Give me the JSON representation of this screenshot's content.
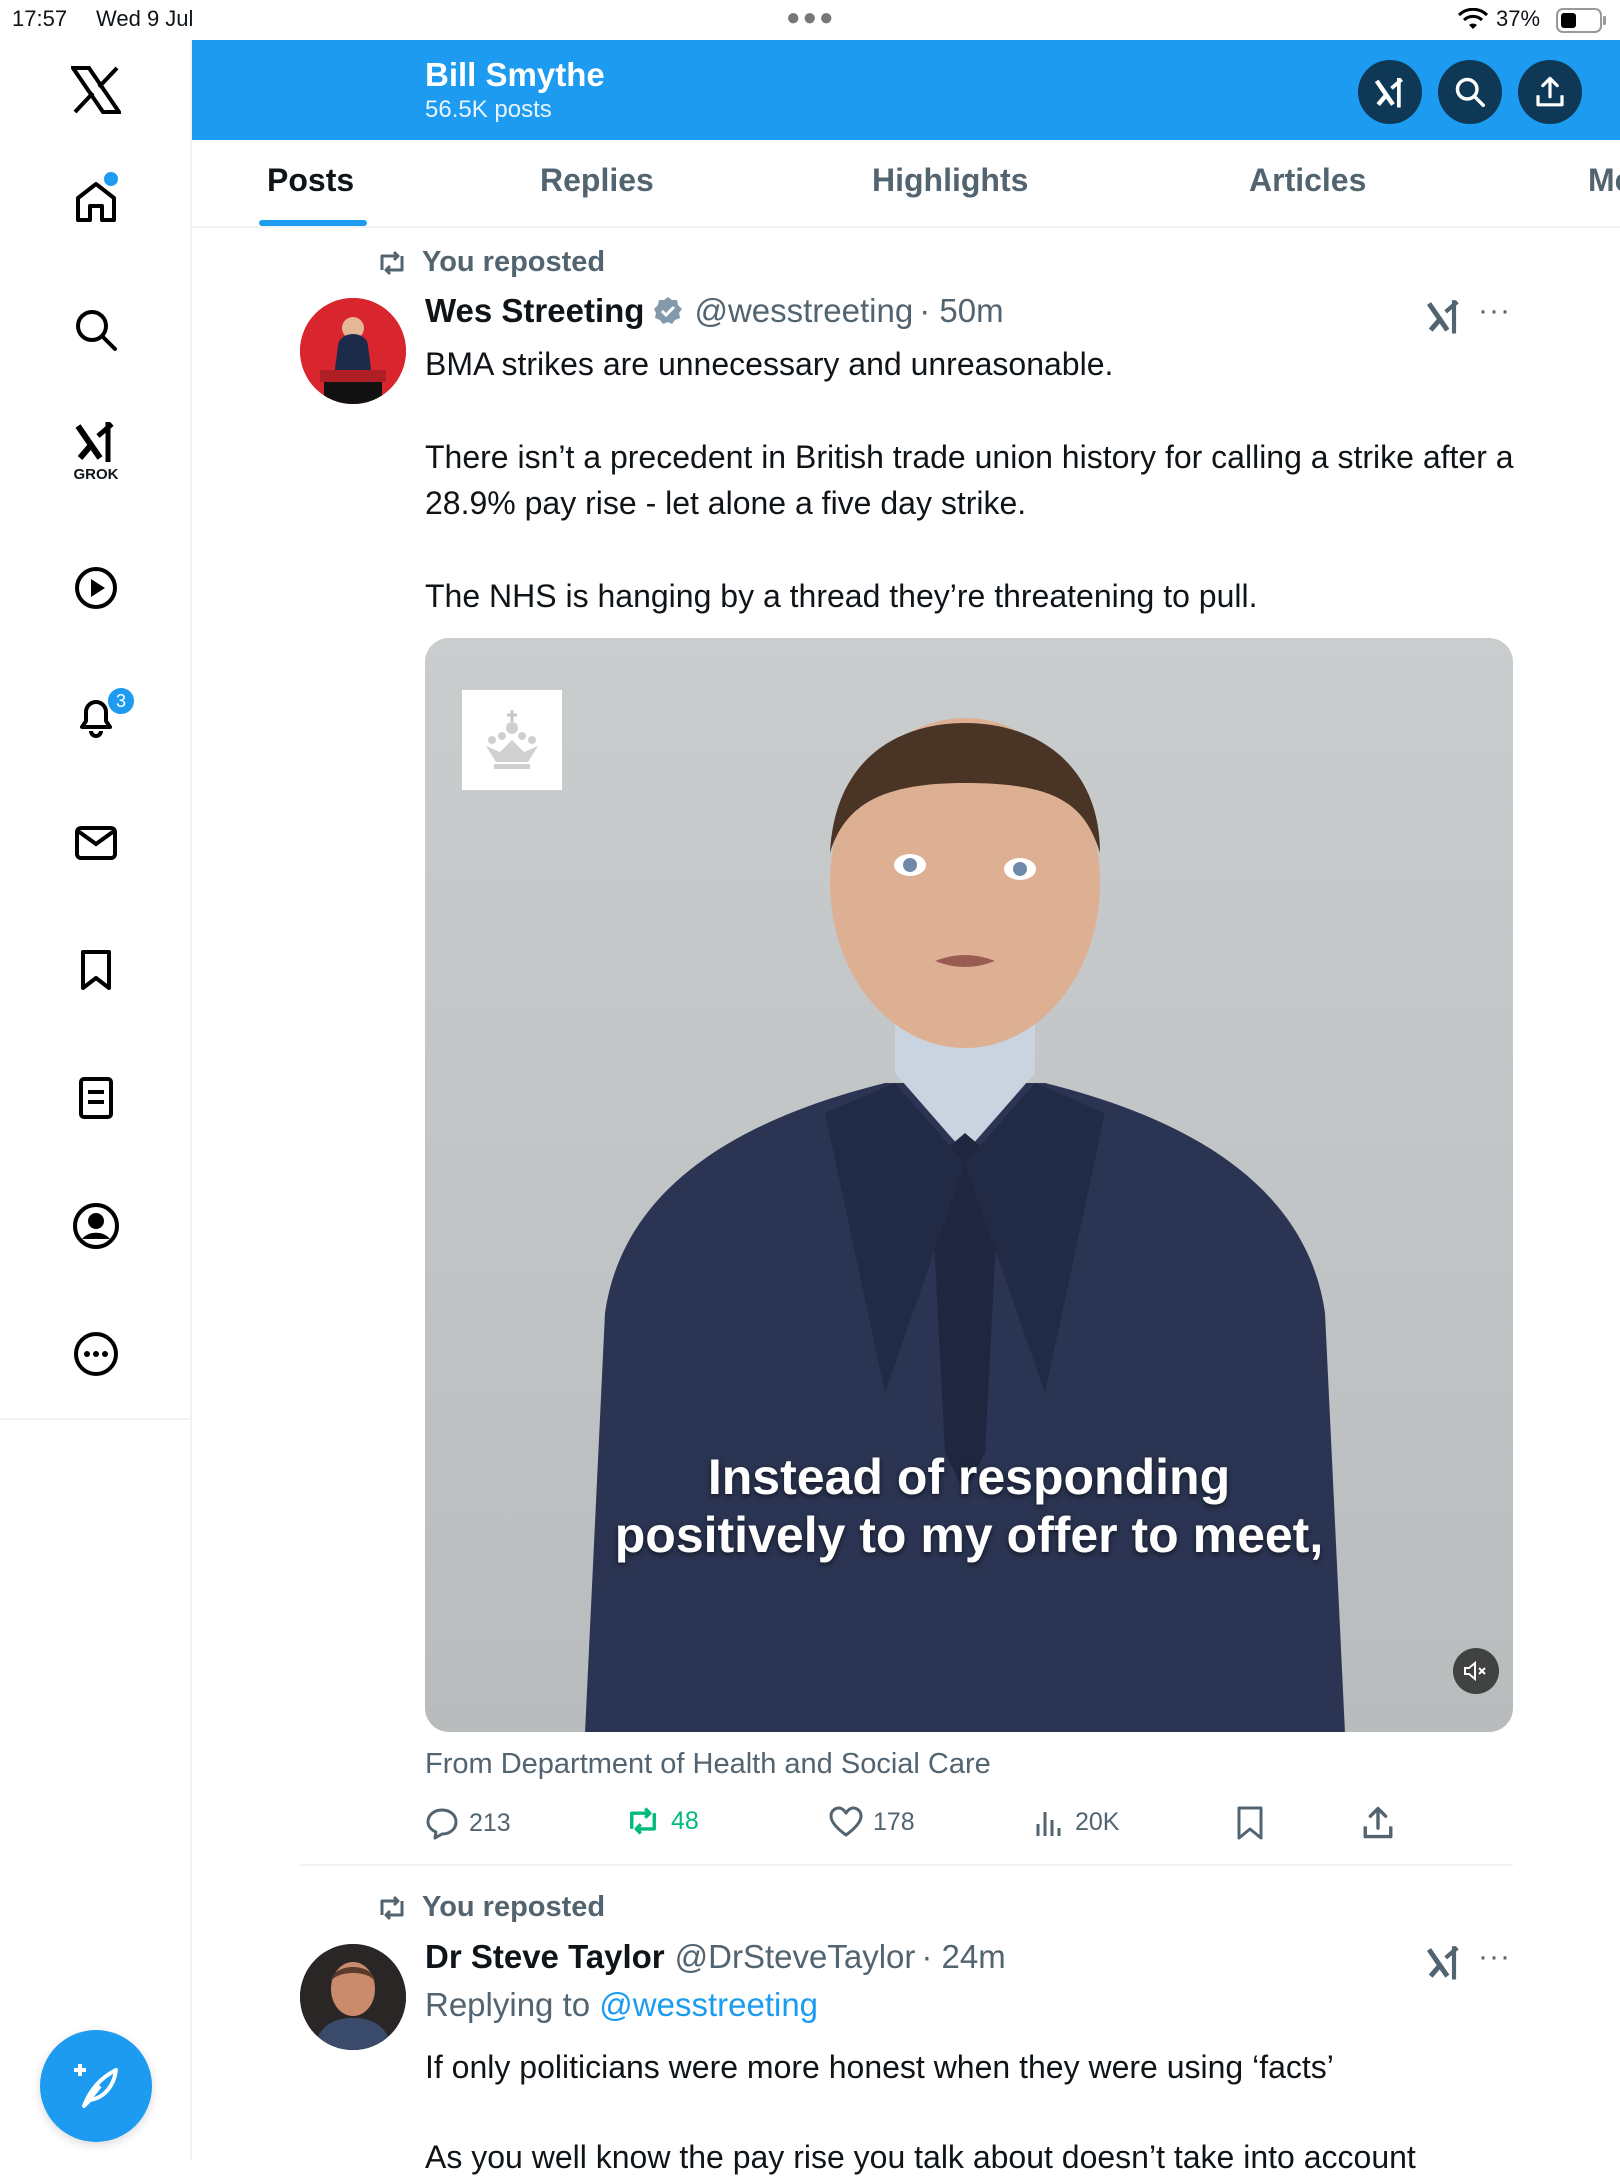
{
  "status_bar": {
    "time": "17:57",
    "date": "Wed 9 Jul",
    "battery": "37%"
  },
  "sidebar": {
    "items": [
      {
        "id": "home",
        "label": ""
      },
      {
        "id": "search",
        "label": ""
      },
      {
        "id": "grok",
        "label": "GROK"
      },
      {
        "id": "video",
        "label": ""
      },
      {
        "id": "notifications",
        "label": "",
        "badge": "3"
      },
      {
        "id": "messages",
        "label": ""
      },
      {
        "id": "bookmarks",
        "label": ""
      },
      {
        "id": "lists",
        "label": ""
      },
      {
        "id": "profile",
        "label": ""
      },
      {
        "id": "more",
        "label": ""
      }
    ]
  },
  "header": {
    "name": "Bill Smythe",
    "post_count": "56.5K posts"
  },
  "tabs": [
    "Posts",
    "Replies",
    "Highlights",
    "Articles",
    "Media"
  ],
  "posts": [
    {
      "repost_label": "You reposted",
      "author": "Wes Streeting",
      "handle": "@wesstreeting",
      "time": "· 50m",
      "text": [
        "BMA strikes are unnecessary and unreasonable.",
        "There isn’t a precedent in British trade union history for calling a strike after a 28.9% pay rise - let alone a five day strike.",
        "The NHS is hanging by a thread they’re threatening to pull."
      ],
      "media_caption_1": "Instead of responding",
      "media_caption_2": "positively to my offer to meet,",
      "source": "From Department of Health and Social Care",
      "stats": {
        "replies": "213",
        "reposts": "48",
        "likes": "178",
        "views": "20K"
      }
    },
    {
      "repost_label": "You reposted",
      "author": "Dr Steve Taylor",
      "handle": "@DrSteveTaylor",
      "time": "· 24m",
      "replying_prefix": "Replying to",
      "replying_to": "@wesstreeting",
      "text": [
        "If only politicians were more honest when they were using ‘facts’",
        "As you well know the pay rise you talk about doesn’t take into account"
      ]
    }
  ],
  "colors": {
    "accent": "#1d9bf0",
    "header_button": "#0f3857",
    "repost_green": "#00ba7c",
    "muted": "#536471"
  }
}
